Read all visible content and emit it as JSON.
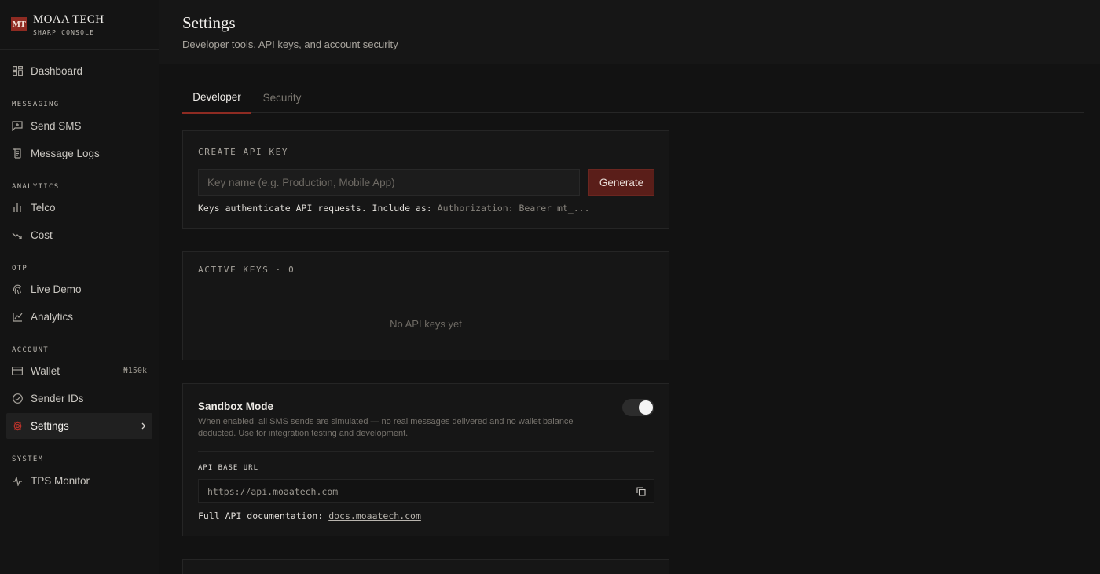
{
  "brand": {
    "logo": "MT",
    "name": "MOAA TECH",
    "subtitle": "SHARP CONSOLE"
  },
  "sidebar": {
    "dashboard": {
      "label": "Dashboard",
      "icon": "grid-icon"
    },
    "sections": {
      "messaging": "MESSAGING",
      "analytics": "ANALYTICS",
      "otp": "OTP",
      "account": "ACCOUNT",
      "system": "SYSTEM"
    },
    "items": {
      "send_sms": "Send SMS",
      "message_logs": "Message Logs",
      "telco": "Telco",
      "cost": "Cost",
      "live_demo": "Live Demo",
      "analytics": "Analytics",
      "wallet": "Wallet",
      "wallet_badge": "₦150k",
      "sender_ids": "Sender IDs",
      "settings": "Settings",
      "tps_monitor": "TPS Monitor"
    }
  },
  "header": {
    "title": "Settings",
    "subtitle": "Developer tools, API keys, and account security"
  },
  "tabs": [
    {
      "label": "Developer",
      "active": true
    },
    {
      "label": "Security",
      "active": false
    }
  ],
  "create_key": {
    "label": "CREATE API KEY",
    "input_placeholder": "Key name (e.g. Production, Mobile App)",
    "button": "Generate",
    "hint_prefix": "Keys authenticate API requests. Include as:",
    "hint_code": "Authorization: Bearer mt_..."
  },
  "active_keys": {
    "label": "ACTIVE KEYS · 0",
    "empty": "No API keys yet"
  },
  "sandbox": {
    "title": "Sandbox Mode",
    "description": "When enabled, all SMS sends are simulated — no real messages delivered and no wallet balance deducted. Use for integration testing and development.",
    "enabled": true,
    "base_url_label": "API BASE URL",
    "base_url": "https://api.moaatech.com",
    "docs_prefix": "Full API documentation:",
    "docs_link": "docs.moaatech.com"
  },
  "colors": {
    "accent": "#8e2b22",
    "background": "#121212",
    "sidebar": "#141414"
  }
}
